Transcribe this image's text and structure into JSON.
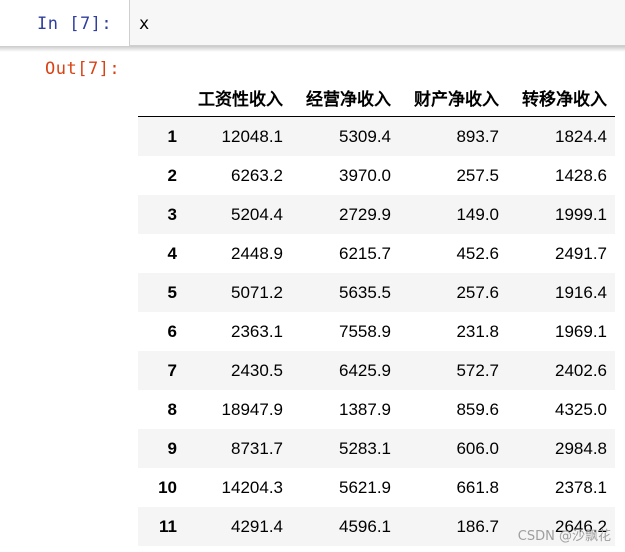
{
  "input_cell": {
    "prompt": "In  [7]:",
    "code": "x"
  },
  "output_cell": {
    "prompt": "Out[7]:"
  },
  "table": {
    "columns": [
      "工资性收入",
      "经营净收入",
      "财产净收入",
      "转移净收入"
    ],
    "rows": [
      {
        "index": "1",
        "values": [
          "12048.1",
          "5309.4",
          "893.7",
          "1824.4"
        ]
      },
      {
        "index": "2",
        "values": [
          "6263.2",
          "3970.0",
          "257.5",
          "1428.6"
        ]
      },
      {
        "index": "3",
        "values": [
          "5204.4",
          "2729.9",
          "149.0",
          "1999.1"
        ]
      },
      {
        "index": "4",
        "values": [
          "2448.9",
          "6215.7",
          "452.6",
          "2491.7"
        ]
      },
      {
        "index": "5",
        "values": [
          "5071.2",
          "5635.5",
          "257.6",
          "1916.4"
        ]
      },
      {
        "index": "6",
        "values": [
          "2363.1",
          "7558.9",
          "231.8",
          "1969.1"
        ]
      },
      {
        "index": "7",
        "values": [
          "2430.5",
          "6425.9",
          "572.7",
          "2402.6"
        ]
      },
      {
        "index": "8",
        "values": [
          "18947.9",
          "1387.9",
          "859.6",
          "4325.0"
        ]
      },
      {
        "index": "9",
        "values": [
          "8731.7",
          "5283.1",
          "606.0",
          "2984.8"
        ]
      },
      {
        "index": "10",
        "values": [
          "14204.3",
          "5621.9",
          "661.8",
          "2378.1"
        ]
      },
      {
        "index": "11",
        "values": [
          "4291.4",
          "4596.1",
          "186.7",
          "2646.2"
        ]
      }
    ]
  },
  "watermark": "CSDN @沙飘花",
  "colors": {
    "in_prompt": "#303f9f",
    "out_prompt": "#d84315",
    "editor_bg": "#f7f7f7",
    "stripe": "#f5f5f5"
  }
}
